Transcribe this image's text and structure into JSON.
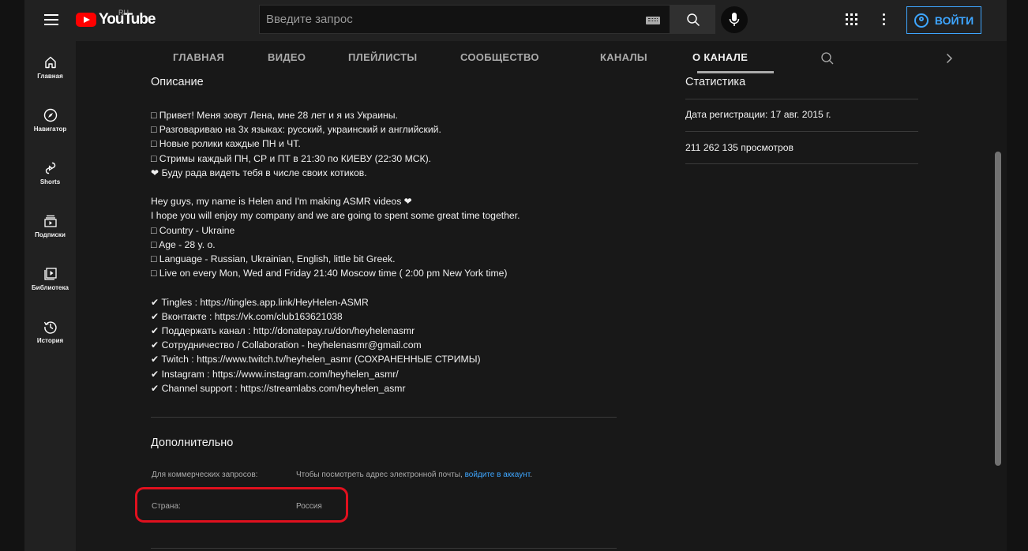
{
  "masthead": {
    "logo_text": "YouTube",
    "region": "RU",
    "search_placeholder": "Введите запрос",
    "signin_label": "ВОЙТИ"
  },
  "sidebar": {
    "items": [
      {
        "label": "Главная",
        "icon": "home-icon"
      },
      {
        "label": "Навигатор",
        "icon": "compass-icon"
      },
      {
        "label": "Shorts",
        "icon": "shorts-icon"
      },
      {
        "label": "Подписки",
        "icon": "subscriptions-icon"
      },
      {
        "label": "Библиотека",
        "icon": "library-icon"
      },
      {
        "label": "История",
        "icon": "history-icon"
      }
    ]
  },
  "tabs": {
    "items": [
      "ГЛАВНАЯ",
      "ВИДЕО",
      "ПЛЕЙЛИСТЫ",
      "СООБЩЕСТВО",
      "КАНАЛЫ",
      "О КАНАЛЕ"
    ],
    "active": "О КАНАЛЕ"
  },
  "about": {
    "description_title": "Описание",
    "description": "□ Привет! Меня зовут Лена, мне 28 лет и я из Украины.\n□ Разговариваю на 3х языках: русский, украинский и английский.\n□ Новые ролики каждые ПН и ЧТ.\n□ Стримы каждый ПН, СР и ПТ в 21:30 по КИЕВУ (22:30 МСК).\n❤ Буду рада видеть тебя в числе своих котиков.\n\nHey guys, my name is Helen and I'm making ASMR videos ❤\nI hope you will enjoy my company and we are going to spent some great time together.\n□ Country - Ukraine\n□ Age - 28 y. o.\n□ Language - Russian, Ukrainian, English, little bit Greek.\n□ Live on every Mon, Wed and Friday 21:40 Moscow time ( 2:00 pm New York time)\n\n✔ Tingles : https://tingles.app.link/HeyHelen-ASMR\n✔ Вконтакте : https://vk.com/club163621038\n✔ Поддержать канал : http://donatepay.ru/don/heyhelenasmr\n✔ Сотрудничество / Collaboration - heyhelenasmr@gmail.com\n✔ Twitch : https://www.twitch.tv/heyhelen_asmr (СОХРАНЕННЫЕ СТРИМЫ)\n✔ Instagram : https://www.instagram.com/heyhelen_asmr/\n✔ Channel support : https://streamlabs.com/heyhelen_asmr",
    "details_title": "Дополнительно",
    "business_label": "Для коммерческих запросов:",
    "business_text": "Чтобы посмотреть адрес электронной почты,",
    "business_link": "войдите в аккаунт",
    "business_suffix": ".",
    "country_label": "Страна:",
    "country_value": "Россия"
  },
  "stats": {
    "title": "Статистика",
    "joined": "Дата регистрации: 17 авг. 2015 г.",
    "views": "211 262 135 просмотров"
  },
  "colors": {
    "accent": "#3ea6ff",
    "highlight": "#e0101e",
    "brand_red": "#ff0000"
  }
}
